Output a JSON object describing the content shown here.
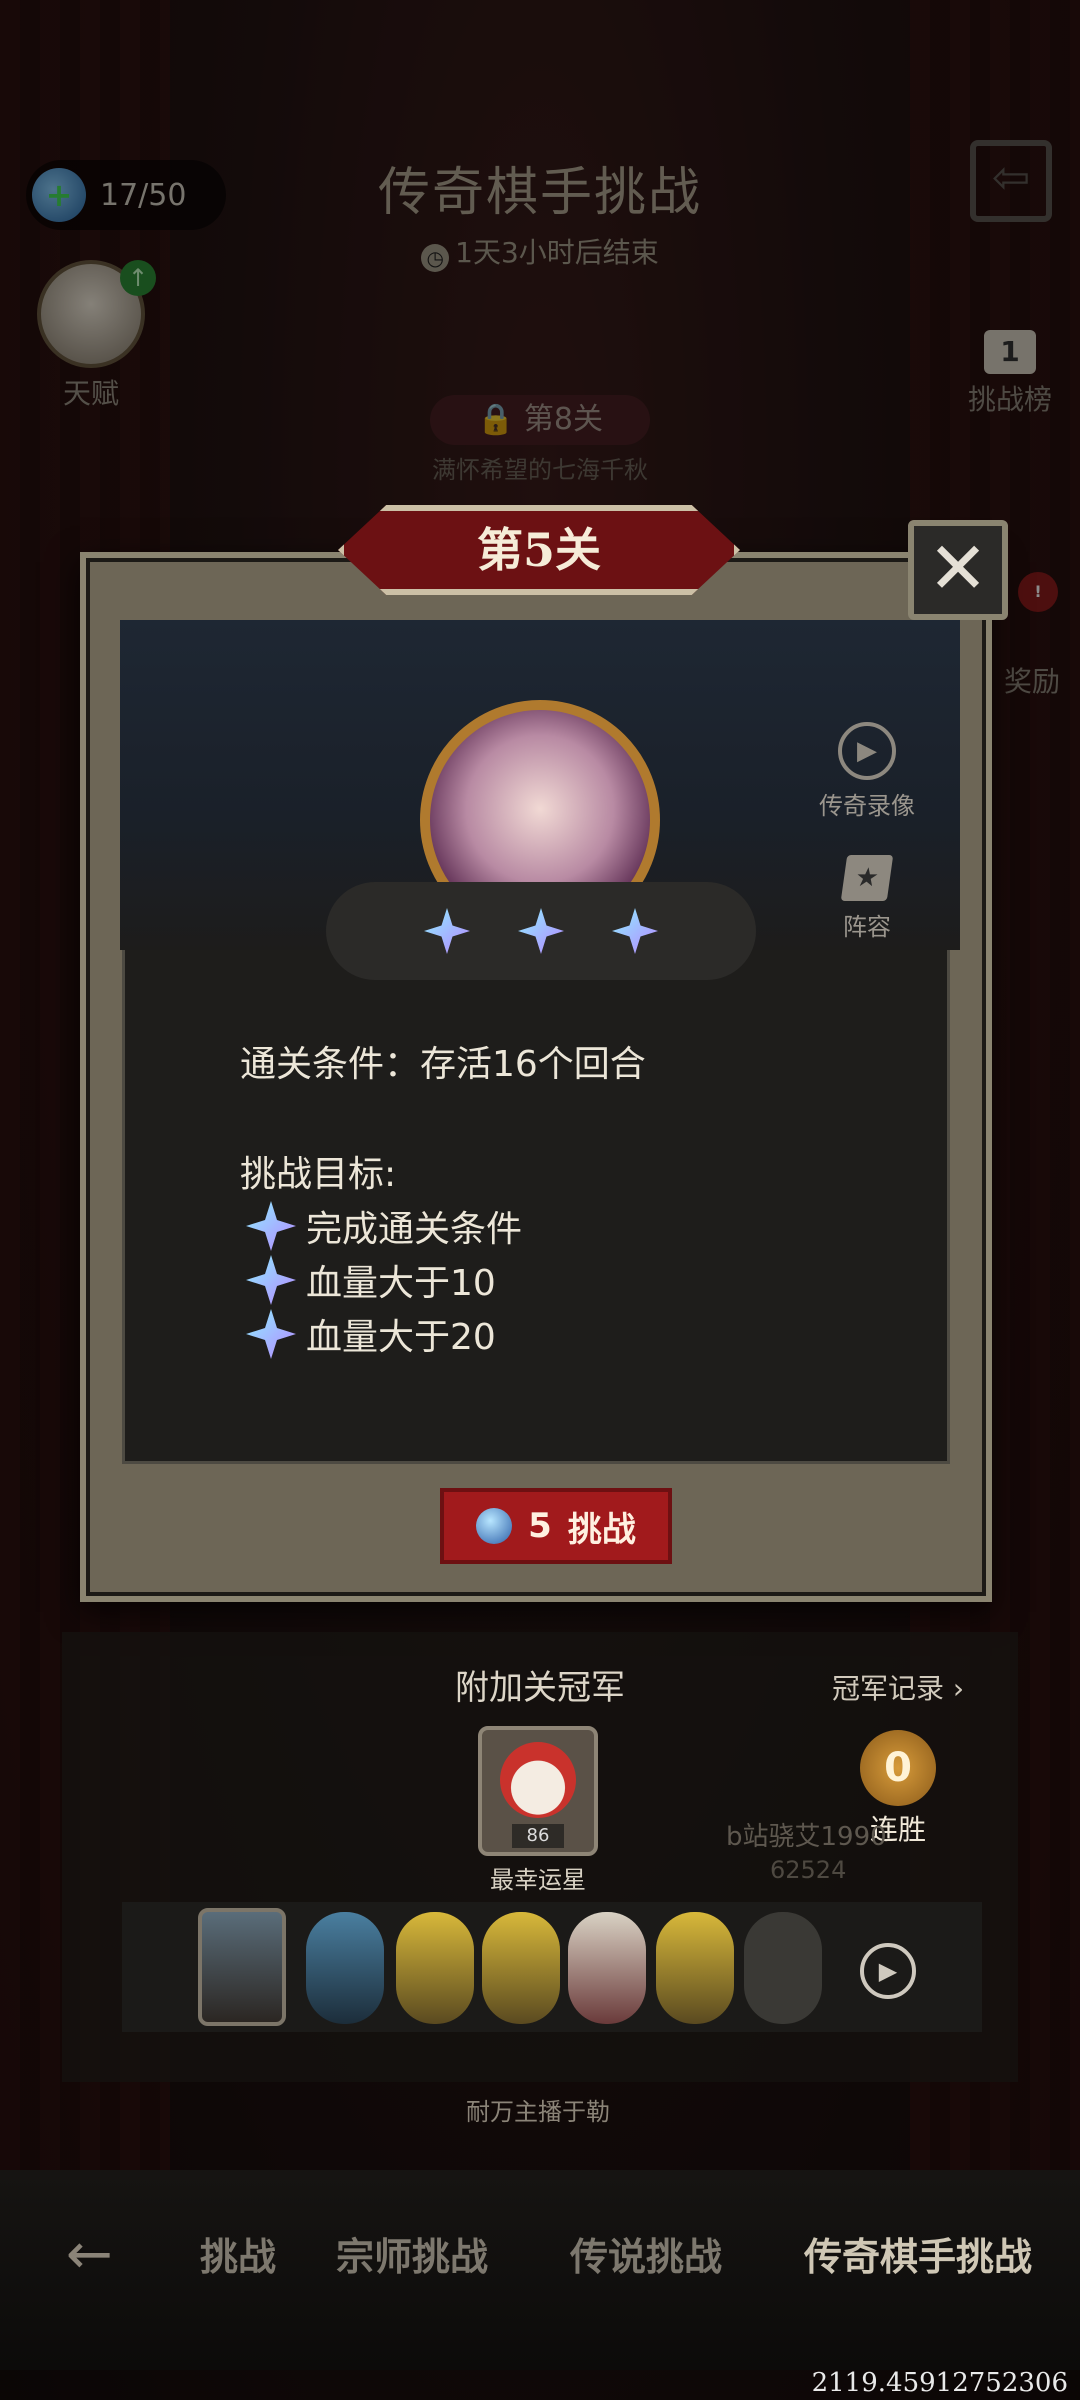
{
  "hud": {
    "energy": "17/50",
    "title": "传奇棋手挑战",
    "countdown": "1天3小时后结束",
    "talent_label": "天赋",
    "ranking_label": "挑战榜",
    "ranking_rank": "1",
    "side_reward_label": "奖励",
    "level8_label": "第8关",
    "level8_sub": "满怀希望的七海千秋"
  },
  "modal": {
    "stage_title": "第5关",
    "replay_label": "传奇录像",
    "lineup_label": "阵容",
    "condition": "通关条件：存活16个回合",
    "goals_title": "挑战目标:",
    "goals": [
      "完成通关条件",
      "血量大于10",
      "血量大于20"
    ],
    "challenge_cost": "5",
    "challenge_label": "挑战"
  },
  "champion": {
    "title": "附加关冠军",
    "record_link": "冠军记录 ›",
    "name": "最幸运星",
    "level": "86",
    "streak": "0",
    "streak_label": "连胜",
    "bg_name": "b站骁艾1990",
    "bg_score": "62524",
    "bg_anchor": "耐万主播于勒"
  },
  "nav": {
    "back_icon": "←",
    "tabs": [
      "挑战",
      "宗师挑战",
      "传说挑战",
      "传奇棋手挑战"
    ]
  },
  "debug_coord": "2119.45912752306",
  "colors": {
    "accent_red": "#a11a1c",
    "gem_gradient": "#8ef0ff-#b685ff",
    "modal_frame": "#6d6656"
  }
}
